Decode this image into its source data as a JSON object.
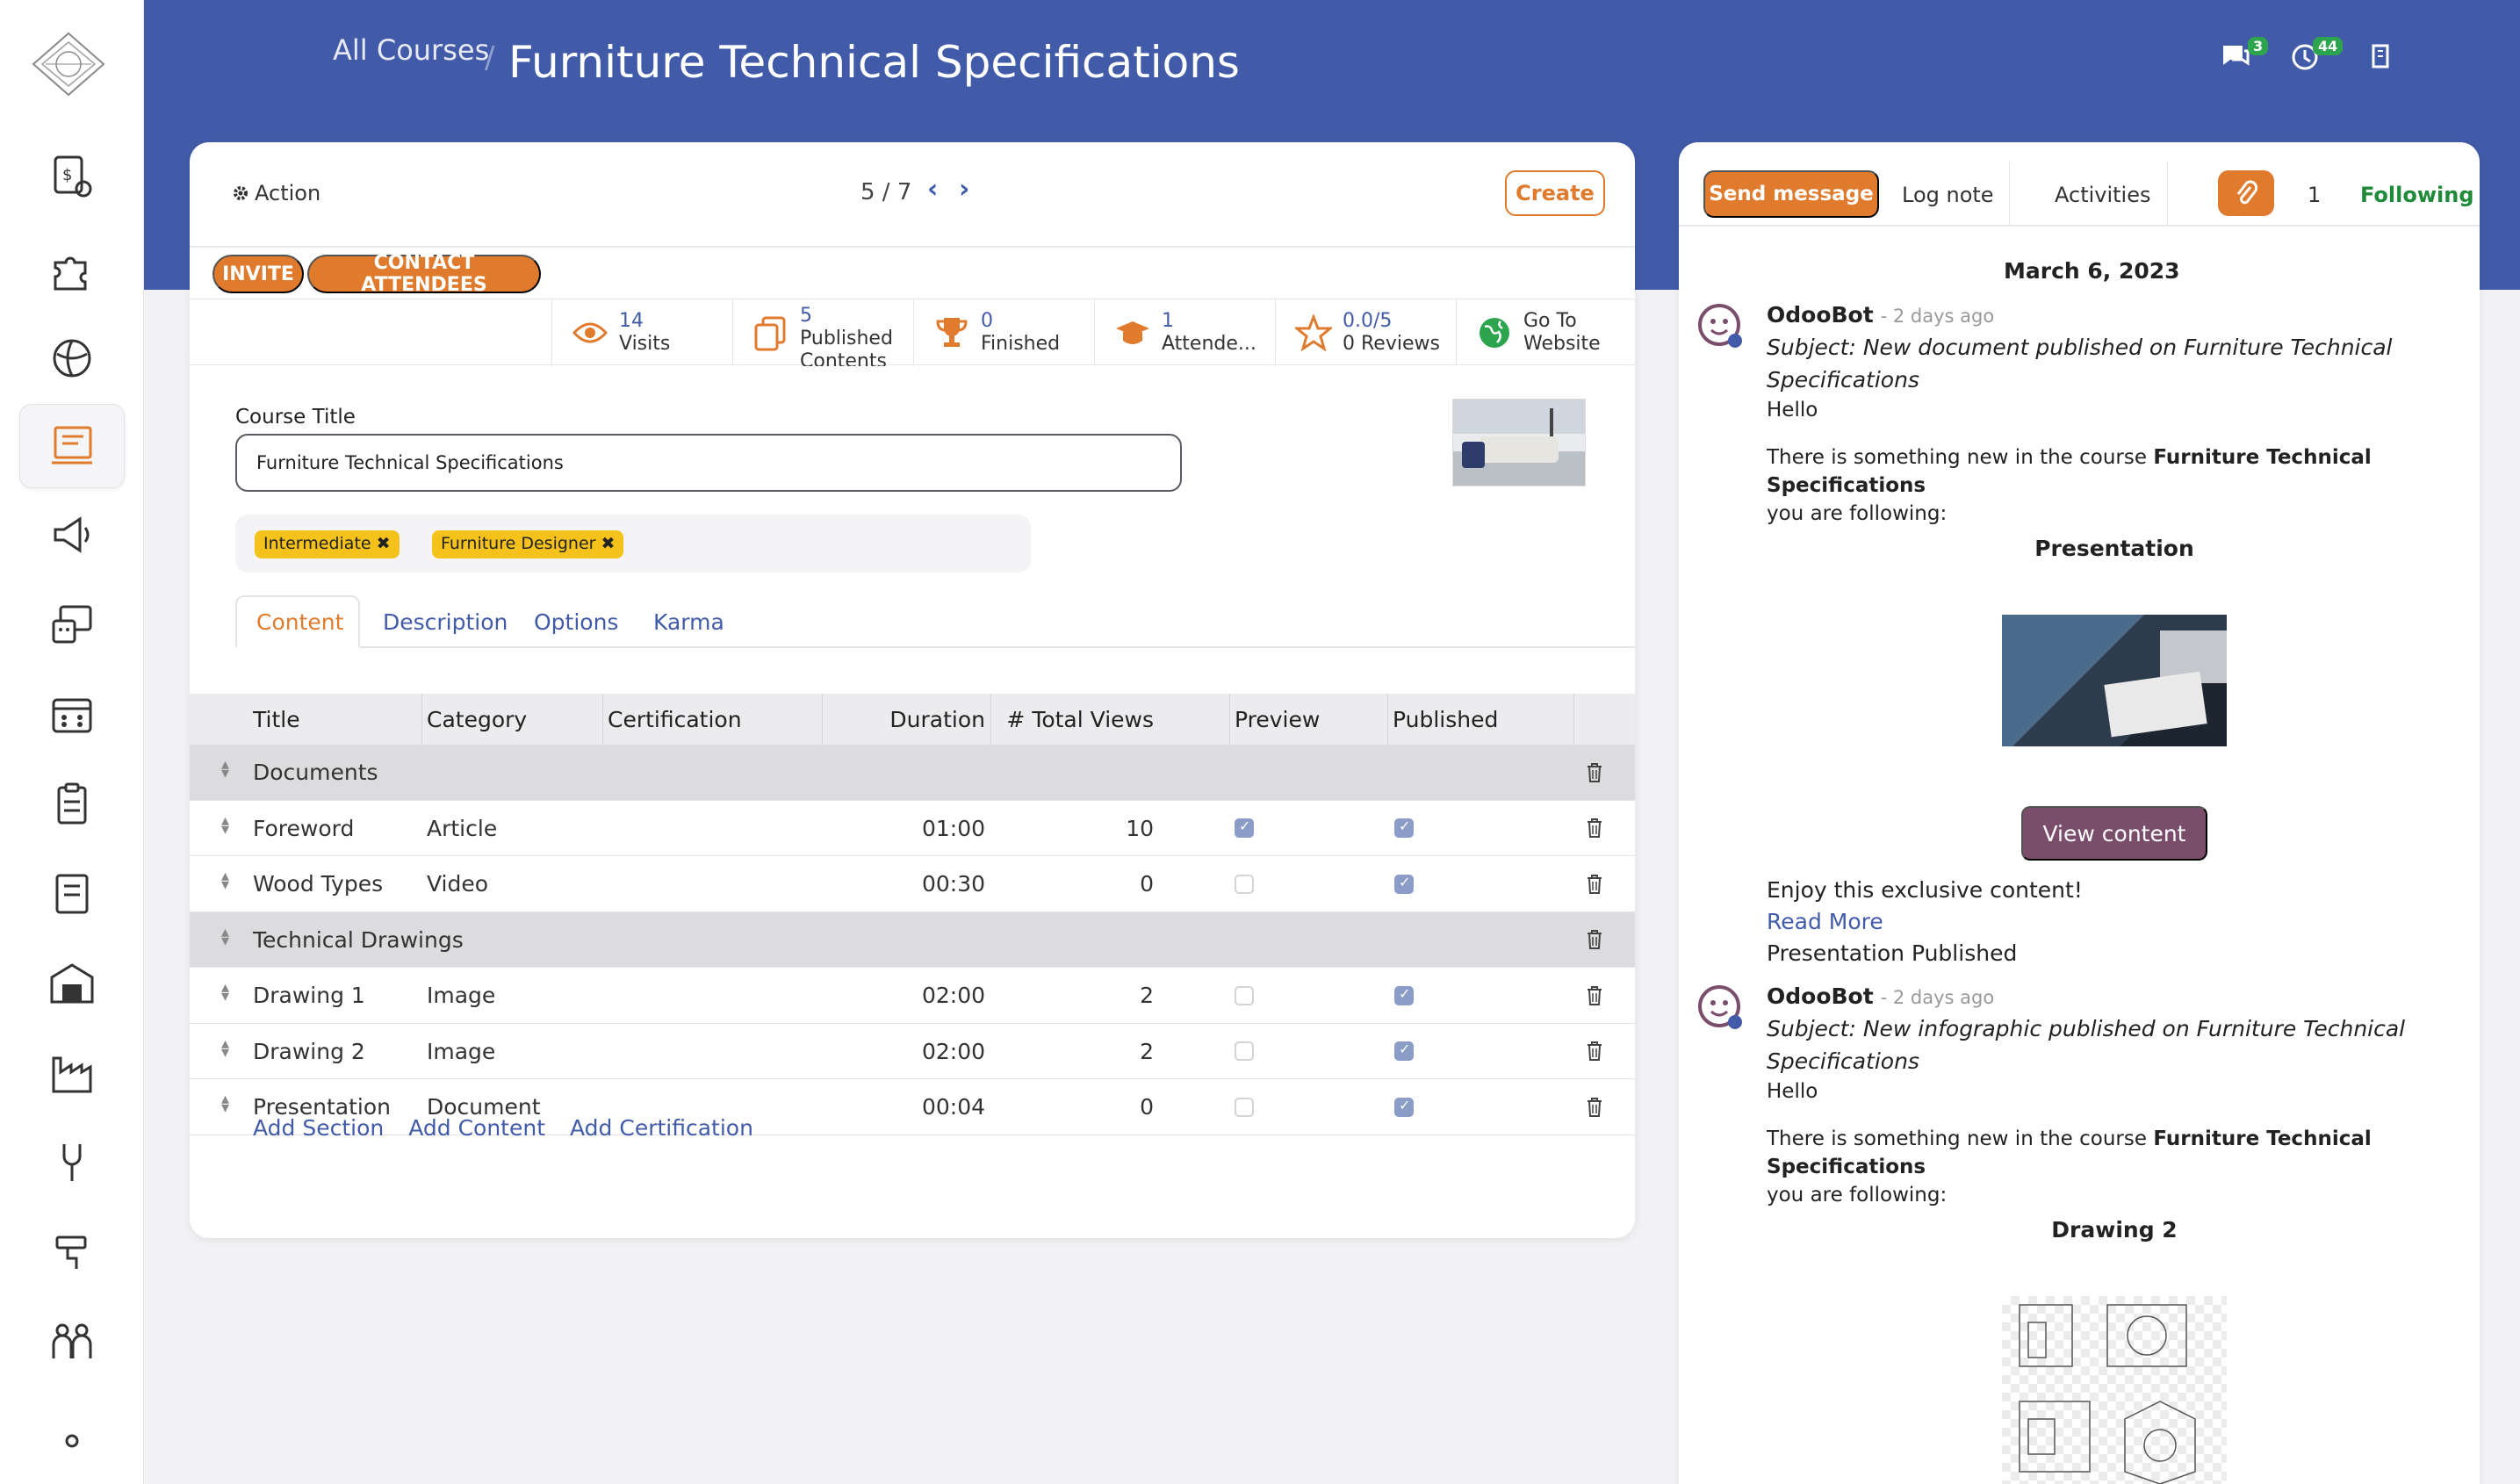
{
  "breadcrumb": {
    "parent": "All Courses",
    "separator": "/",
    "current": "Furniture Technical Specifications"
  },
  "header": {
    "messages_badge": "3",
    "activities_badge": "44"
  },
  "sidebar": {
    "items": [
      "accounting-icon",
      "apps-icon",
      "website-icon",
      "elearning-icon",
      "marketing-icon",
      "helpdesk-icon",
      "events-icon",
      "surveys-icon",
      "documents-icon",
      "inventory-icon",
      "manufacturing-icon",
      "maintenance-icon",
      "repair-icon",
      "employees-icon",
      "more-icon"
    ],
    "active": "elearning-icon"
  },
  "control": {
    "action_label": "Action",
    "pager": "5 / 7",
    "create_label": "Create"
  },
  "status_buttons": {
    "invite": "INVITE",
    "contact": "CONTACT ATTENDEES"
  },
  "smart_buttons": [
    {
      "value": "14",
      "label": "Visits",
      "icon": "eye-icon"
    },
    {
      "value": "5",
      "label": "Published",
      "label2": "Contents",
      "icon": "copy-icon"
    },
    {
      "value": "0",
      "label": "Finished",
      "icon": "trophy-icon"
    },
    {
      "value": "1",
      "label": "Attende...",
      "icon": "graduation-cap-icon"
    },
    {
      "value": "0.0/5",
      "label": "0 Reviews",
      "icon": "star-icon"
    },
    {
      "value": "Go To",
      "label": "Website",
      "icon": "globe-icon"
    }
  ],
  "form": {
    "title_label": "Course Title",
    "title_value": "Furniture Technical Specifications",
    "tags": [
      "Intermediate",
      "Furniture Designer"
    ]
  },
  "tabs": [
    "Content",
    "Description",
    "Options",
    "Karma"
  ],
  "table": {
    "headers": [
      "Title",
      "Category",
      "Certification",
      "Duration",
      "# Total Views",
      "Preview",
      "Published"
    ],
    "rows": [
      {
        "type": "section",
        "title": "Documents"
      },
      {
        "type": "line",
        "title": "Foreword",
        "category": "Article",
        "certification": "",
        "duration": "01:00",
        "views": "10",
        "preview": true,
        "published": true
      },
      {
        "type": "line",
        "title": "Wood Types",
        "category": "Video",
        "certification": "",
        "duration": "00:30",
        "views": "0",
        "preview": false,
        "published": true
      },
      {
        "type": "section",
        "title": "Technical Drawings"
      },
      {
        "type": "line",
        "title": "Drawing 1",
        "category": "Image",
        "certification": "",
        "duration": "02:00",
        "views": "2",
        "preview": false,
        "published": true
      },
      {
        "type": "line",
        "title": "Drawing 2",
        "category": "Image",
        "certification": "",
        "duration": "02:00",
        "views": "2",
        "preview": false,
        "published": true
      },
      {
        "type": "line",
        "title": "Presentation",
        "category": "Document",
        "certification": "",
        "duration": "00:04",
        "views": "0",
        "preview": false,
        "published": true
      }
    ],
    "add_links": [
      "Add Section",
      "Add Content",
      "Add Certification"
    ]
  },
  "chatter": {
    "send_message": "Send message",
    "log_note": "Log note",
    "activities": "Activities",
    "attachments_count": "1",
    "following": "Following",
    "date": "March 6, 2023",
    "messages": [
      {
        "author": "OdooBot",
        "ago": "- 2 days ago",
        "subject": "Subject: New document published on Furniture Technical Specifications",
        "hello": "Hello",
        "intro": "There is something new in the course",
        "course": "Furniture Technical Specifications",
        "following": "you are following:",
        "item": "Presentation",
        "view_button": "View content",
        "enjoy": "Enjoy this exclusive content!",
        "read_more": "Read More",
        "footer": "Presentation Published"
      },
      {
        "author": "OdooBot",
        "ago": "- 2 days ago",
        "subject": "Subject: New infographic published on Furniture Technical Specifications",
        "hello": "Hello",
        "intro": "There is something new in the course",
        "course": "Furniture Technical Specifications",
        "following": "you are following:",
        "item": "Drawing 2"
      }
    ]
  },
  "colors": {
    "brand": "#425ba8",
    "accent": "#e07b2d",
    "tag": "#f4c21b",
    "view_button": "#7a4d6b",
    "following": "#1f8a3a"
  }
}
